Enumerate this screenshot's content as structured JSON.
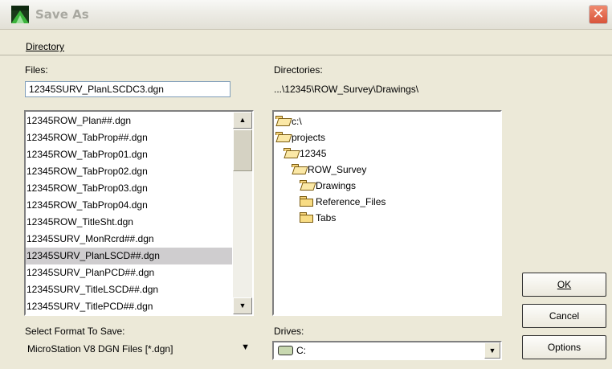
{
  "window": {
    "title": "Save As",
    "close_glyph": "✕"
  },
  "menu": {
    "directory": "Directory"
  },
  "files": {
    "label": "Files:",
    "value": "12345SURV_PlanLSCDC3.dgn",
    "items": [
      "12345ROW_Plan##.dgn",
      "12345ROW_TabProp##.dgn",
      "12345ROW_TabProp01.dgn",
      "12345ROW_TabProp02.dgn",
      "12345ROW_TabProp03.dgn",
      "12345ROW_TabProp04.dgn",
      "12345ROW_TitleSht.dgn",
      "12345SURV_MonRcrd##.dgn",
      "12345SURV_PlanLSCD##.dgn",
      "12345SURV_PlanPCD##.dgn",
      "12345SURV_TitleLSCD##.dgn",
      "12345SURV_TitlePCD##.dgn"
    ],
    "selected_index": 8
  },
  "directories": {
    "label": "Directories:",
    "current_path": "...\\12345\\ROW_Survey\\Drawings\\",
    "tree": [
      {
        "name": "c:\\",
        "state": "open",
        "depth": 0
      },
      {
        "name": "projects",
        "state": "open",
        "depth": 0
      },
      {
        "name": "12345",
        "state": "open",
        "depth": 1
      },
      {
        "name": "ROW_Survey",
        "state": "open",
        "depth": 2
      },
      {
        "name": "Drawings",
        "state": "open",
        "depth": 3
      },
      {
        "name": "Reference_Files",
        "state": "closed",
        "depth": 3
      },
      {
        "name": "Tabs",
        "state": "closed",
        "depth": 3
      }
    ]
  },
  "format": {
    "label": "Select Format To Save:",
    "value": "MicroStation V8 DGN Files [*.dgn]"
  },
  "drives": {
    "label": "Drives:",
    "value": "C:"
  },
  "buttons": {
    "ok": "OK",
    "cancel": "Cancel",
    "options": "Options"
  },
  "icons": {
    "app": "microstation-icon",
    "folder": "folder-icon",
    "drive": "drive-icon"
  }
}
